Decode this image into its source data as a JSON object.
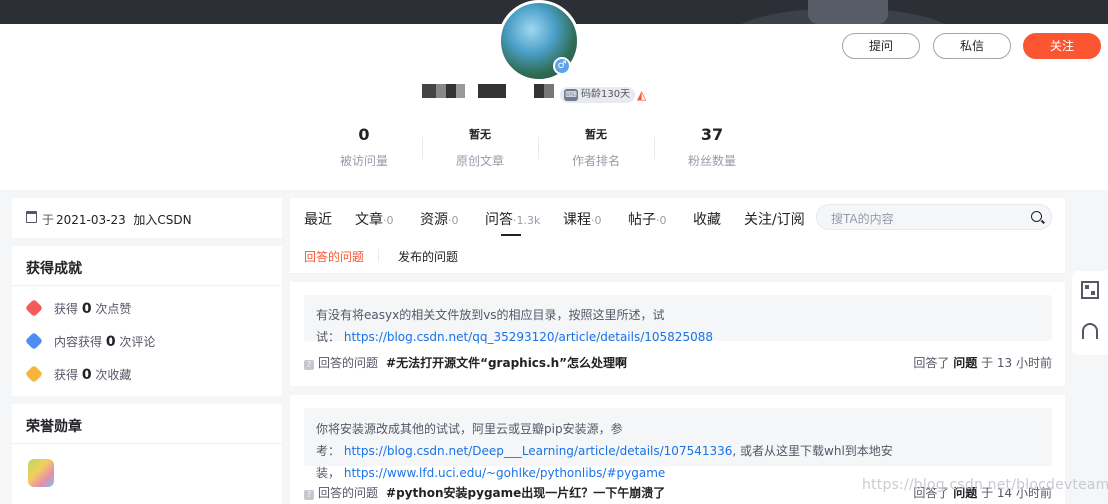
{
  "header": {
    "ask_button": "提问",
    "message_button": "私信",
    "follow_button": "关注",
    "code_age": "码龄130天",
    "username_masked": true
  },
  "stats": [
    {
      "value": "0",
      "label": "被访问量"
    },
    {
      "value": "暂无",
      "label": "原创文章"
    },
    {
      "value": "暂无",
      "label": "作者排名"
    },
    {
      "value": "37",
      "label": "粉丝数量"
    }
  ],
  "join": {
    "prefix": "于",
    "date": "2021-03-23",
    "suffix": "加入CSDN"
  },
  "achievements": {
    "title": "获得成就",
    "items": [
      {
        "pre": "获得",
        "num": "0",
        "post": "次点赞",
        "color": "#f45a5a"
      },
      {
        "pre": "内容获得",
        "num": "0",
        "post": "次评论",
        "color": "#4b8ff0"
      },
      {
        "pre": "获得",
        "num": "0",
        "post": "次收藏",
        "color": "#f6b53d"
      }
    ]
  },
  "medals": {
    "title": "荣誉勋章"
  },
  "tabs": [
    {
      "label": "最近",
      "count": ""
    },
    {
      "label": "文章",
      "count": "·0"
    },
    {
      "label": "资源",
      "count": "·0"
    },
    {
      "label": "问答",
      "count": "·1.3k"
    },
    {
      "label": "课程",
      "count": "·0"
    },
    {
      "label": "帖子",
      "count": "·0"
    },
    {
      "label": "收藏",
      "count": ""
    },
    {
      "label": "关注/订阅",
      "count": ""
    }
  ],
  "search": {
    "placeholder": "搜TA的内容"
  },
  "subtabs": {
    "answered": "回答的问题",
    "published": "发布的问题"
  },
  "answers": [
    {
      "text": "有没有将easyx的相关文件放到vs的相应目录，按照这里所述，试试：",
      "link": "https://blog.csdn.net/qq_35293120/article/details/105825088",
      "text2": "",
      "link2": "",
      "text3": "",
      "foot_label": "回答的问题",
      "question": "#无法打开源文件“graphics.h”怎么处理啊",
      "right_pre": "回答了",
      "right_bold": "问题",
      "right_post": "于 13 小时前"
    },
    {
      "text": "你将安装源改成其他的试试，阿里云或豆瓣pip安装源，参考：",
      "link": "https://blog.csdn.net/Deep___Learning/article/details/107541336",
      "text2": ", 或者从这里下载whl到本地安装，",
      "link2": "https://www.lfd.uci.edu/~gohlke/pythonlibs/#pygame",
      "text3": "",
      "foot_label": "回答的问题",
      "question": "#python安装pygame出现一片红？一下午崩溃了",
      "right_pre": "回答了",
      "right_bold": "问题",
      "right_post": "于 14 小时前"
    }
  ],
  "watermark": "https://blog.csdn.net/blocdevteam"
}
